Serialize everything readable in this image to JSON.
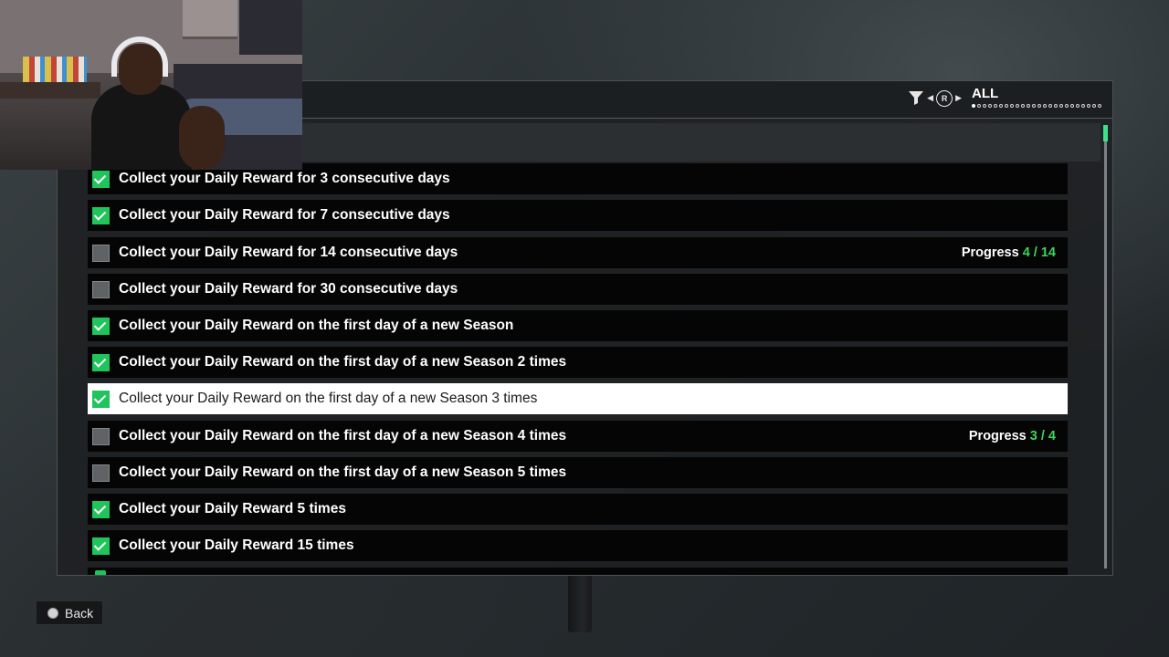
{
  "filter": {
    "value": "ALL",
    "page_count": 24,
    "active_page": 1,
    "button_glyph": "R"
  },
  "challenges": [
    {
      "label": "Collect your Daily Reward for 3 consecutive days",
      "completed": true
    },
    {
      "label": "Collect your Daily Reward for 7 consecutive days",
      "completed": true
    },
    {
      "label": "Collect your Daily Reward for 14 consecutive days",
      "completed": false,
      "progress_label": "Progress",
      "progress_value": "4 / 14"
    },
    {
      "label": "Collect your Daily Reward for 30 consecutive days",
      "completed": false
    },
    {
      "label": "Collect your Daily Reward on the first day of a new Season",
      "completed": true
    },
    {
      "label": "Collect your Daily Reward on the first day of a new Season 2 times",
      "completed": true
    },
    {
      "label": "Collect your Daily Reward on the first day of a new Season 3 times",
      "completed": true,
      "selected": true
    },
    {
      "label": "Collect your Daily Reward on the first day of a new Season 4 times",
      "completed": false,
      "progress_label": "Progress",
      "progress_value": "3 / 4"
    },
    {
      "label": "Collect your Daily Reward on the first day of a new Season 5 times",
      "completed": false
    },
    {
      "label": "Collect your Daily Reward 5 times",
      "completed": true
    },
    {
      "label": "Collect your Daily Reward 15 times",
      "completed": true
    }
  ],
  "footer": {
    "back_label": "Back"
  },
  "colors": {
    "complete_check": "#1fc45b",
    "progress_value": "#3bd35f",
    "scroll_thumb": "#3fe08a"
  },
  "icons": {
    "filter": "funnel-icon",
    "back": "circle-button-icon"
  }
}
